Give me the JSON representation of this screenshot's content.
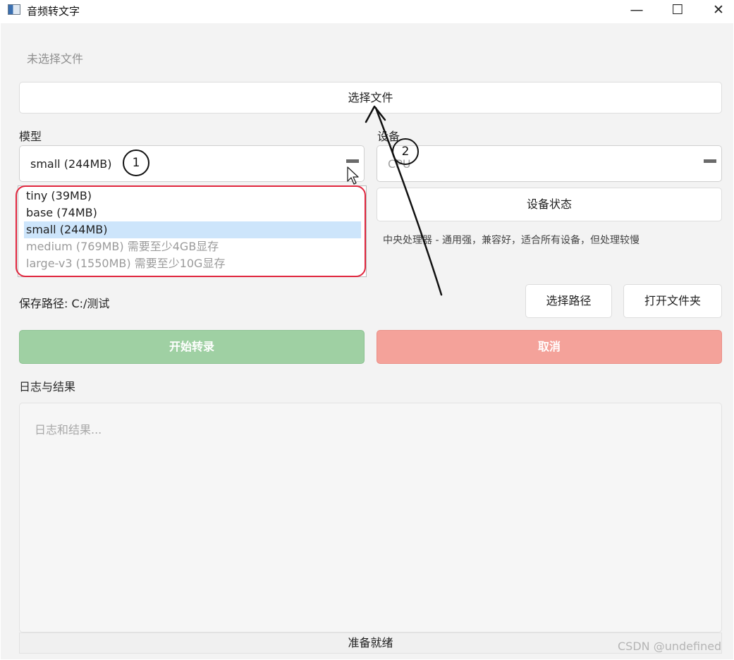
{
  "window": {
    "title": "音频转文字",
    "icon": "app-icon",
    "controls": {
      "minimize": "—",
      "maximize": "☐",
      "close": "✕"
    }
  },
  "file": {
    "status": "未选择文件",
    "select_button": "选择文件"
  },
  "model": {
    "label": "模型",
    "selected": "small (244MB)",
    "options": [
      {
        "label": "tiny (39MB)",
        "enabled": true,
        "selected": false
      },
      {
        "label": "base (74MB)",
        "enabled": true,
        "selected": false
      },
      {
        "label": "small (244MB)",
        "enabled": true,
        "selected": true
      },
      {
        "label": "medium (769MB) 需要至少4GB显存",
        "enabled": false,
        "selected": false
      },
      {
        "label": "large-v3 (1550MB) 需要至少10G显存",
        "enabled": false,
        "selected": false
      }
    ]
  },
  "device": {
    "label": "设备",
    "selected": "CPU",
    "status_button": "设备状态",
    "description": "中央处理器 - 通用强，兼容好，适合所有设备，但处理较慢"
  },
  "save": {
    "path_text": "保存路径: C:/测试",
    "choose_button": "选择路径",
    "open_button": "打开文件夹"
  },
  "actions": {
    "start": "开始转录",
    "cancel": "取消",
    "start_color": "#9fd0a3",
    "cancel_color": "#f4a29a"
  },
  "log": {
    "label": "日志与结果",
    "placeholder": "日志和结果..."
  },
  "status_bar": "准备就绪",
  "annotations": {
    "one": "1",
    "two": "2"
  },
  "watermark": "CSDN @undefined"
}
